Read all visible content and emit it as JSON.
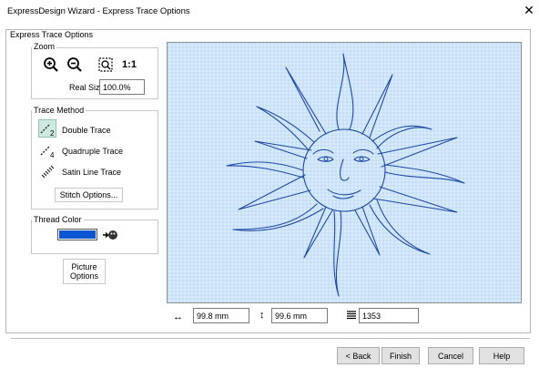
{
  "window": {
    "title": "ExpressDesign Wizard - Express Trace Options",
    "close_glyph": "✕"
  },
  "panel": {
    "title": "Express Trace Options"
  },
  "zoom": {
    "label": "Zoom",
    "one_to_one": "1:1",
    "real_size_label": "Real Size",
    "real_size_value": "100.0%"
  },
  "trace_method": {
    "label": "Trace Method",
    "options": [
      "Double Trace",
      "Quadruple Trace",
      "Satin Line Trace"
    ],
    "selected": "Double Trace",
    "stitch_options": "Stitch Options..."
  },
  "thread_color": {
    "label": "Thread Color",
    "color": "#0a55d2"
  },
  "picture_options": {
    "line1": "Picture",
    "line2": "Options"
  },
  "status": {
    "width": "99.8 mm",
    "height": "99.6 mm",
    "stitches": "1353"
  },
  "footer": {
    "back": "< Back",
    "finish": "Finish",
    "cancel": "Cancel",
    "help": "Help"
  },
  "colors": {
    "preview_bg": "#cfe5fa",
    "stitch_line": "#1f4aa3",
    "accent_sel": "#cfe8e1"
  }
}
